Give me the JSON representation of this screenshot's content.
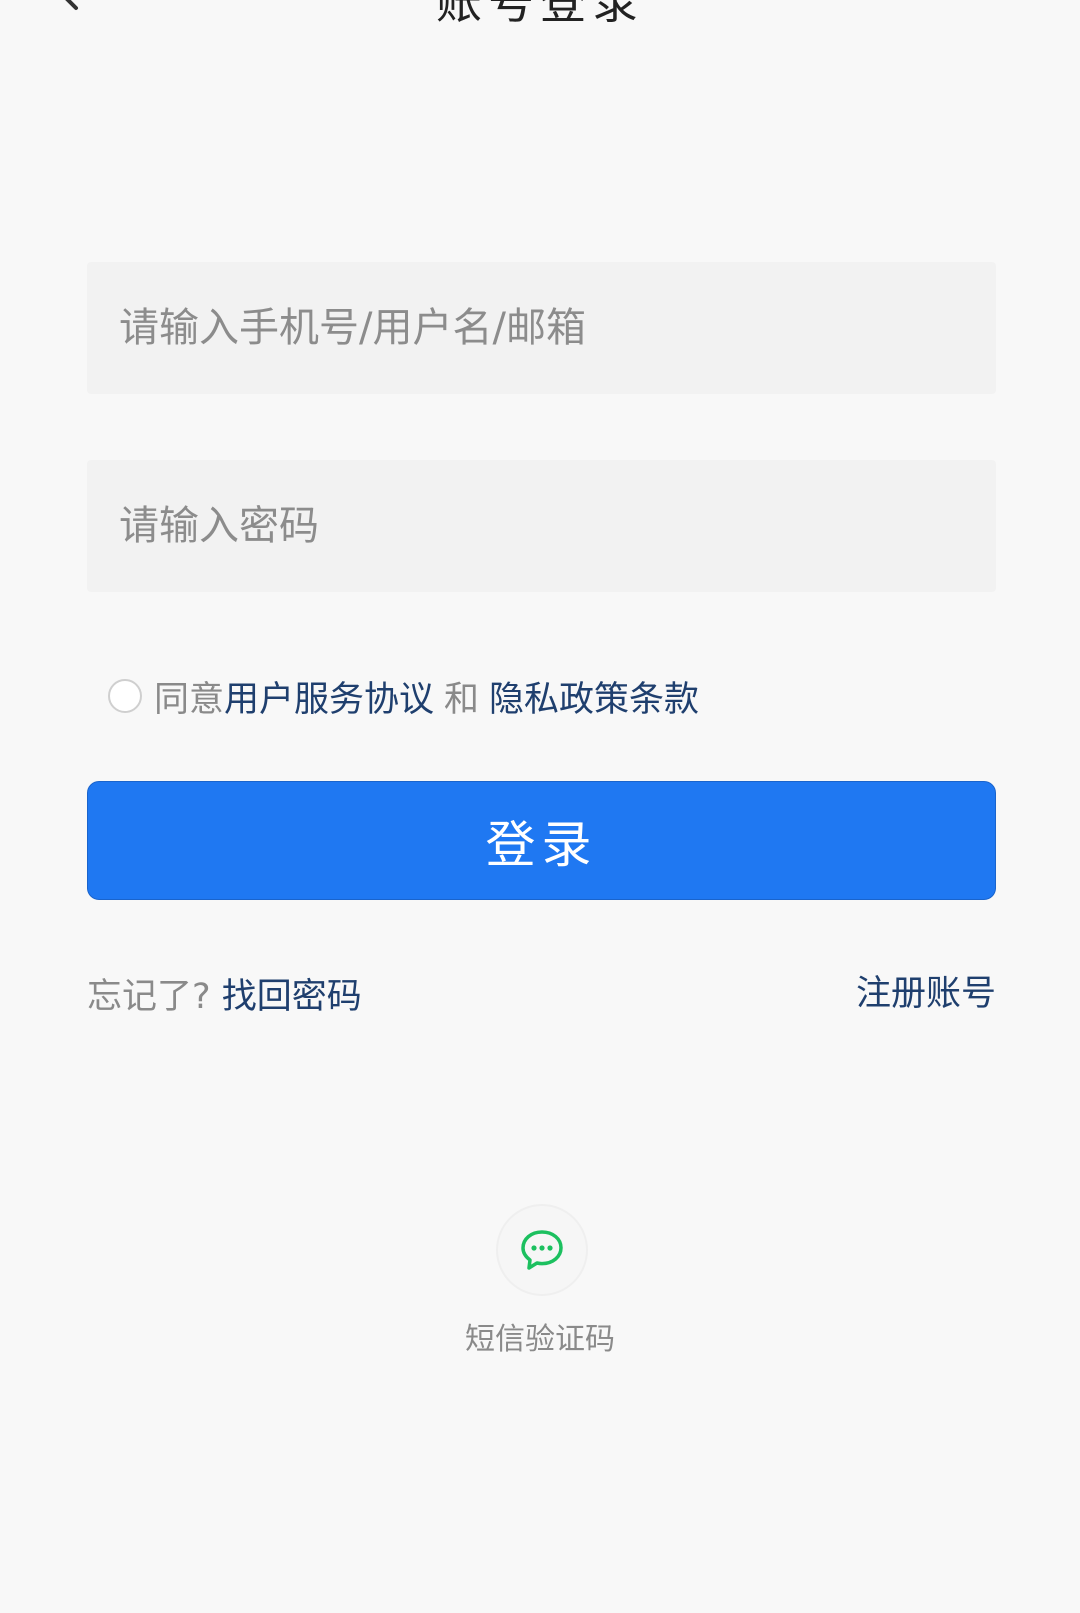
{
  "header": {
    "title": "账号登录"
  },
  "form": {
    "username_placeholder": "请输入手机号/用户名/邮箱",
    "password_placeholder": "请输入密码",
    "agree_prefix": "同意",
    "terms_link": "用户服务协议",
    "agree_and": "和",
    "privacy_link": "隐私政策条款",
    "login_label": "登录"
  },
  "links": {
    "forgot_prefix": "忘记了?",
    "recover_password": "找回密码",
    "register": "注册账号"
  },
  "alt_login": {
    "sms_label": "短信验证码",
    "icon": "chat-bubble-icon",
    "icon_color": "#1cc05f"
  },
  "colors": {
    "accent": "#1f78f2",
    "link": "#1f3f6e",
    "background": "#f8f8f8"
  }
}
